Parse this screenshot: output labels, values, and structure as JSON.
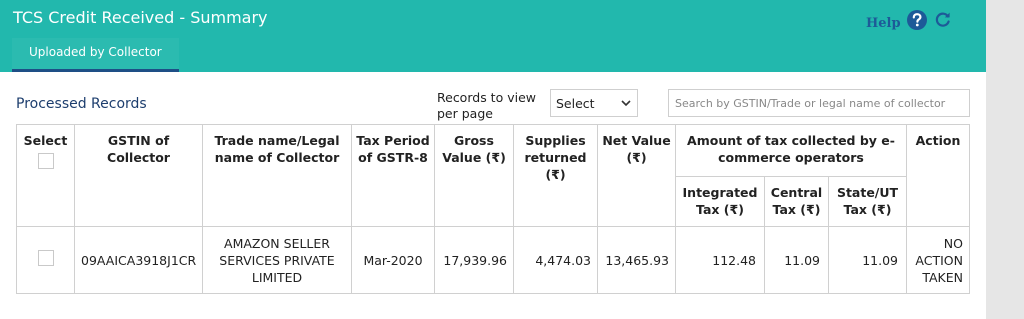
{
  "header": {
    "title": "TCS Credit Received - Summary",
    "help_label": "Help",
    "tab_label": "Uploaded by Collector",
    "help_icon": "help-circle-icon",
    "refresh_icon": "refresh-icon",
    "accent_color": "#22b8ad"
  },
  "toolbar": {
    "section_title": "Processed Records",
    "records_label": "Records to view per page",
    "select_value": "Select",
    "search_placeholder": "Search by GSTIN/Trade or legal name of collector"
  },
  "table": {
    "headers": {
      "select": "Select",
      "gstin": "GSTIN of Collector",
      "trade_name": "Trade name/Legal name of Collector",
      "tax_period": "Tax Period of GSTR-8",
      "gross_value": "Gross Value (₹)",
      "supplies_returned": "Supplies returned (₹)",
      "net_value": "Net Value (₹)",
      "amount_tax": "Amount of tax collected by e-commerce operators",
      "action": "Action",
      "integrated_tax": "Integrated Tax (₹)",
      "central_tax": "Central Tax (₹)",
      "state_ut_tax": "State/UT Tax (₹)"
    },
    "rows": [
      {
        "gstin": "09AAICA3918J1CR",
        "trade_name": "AMAZON SELLER SERVICES PRIVATE LIMITED",
        "tax_period": "Mar-2020",
        "gross_value": "17,939.96",
        "supplies_returned": "4,474.03",
        "net_value": "13,465.93",
        "integrated_tax": "112.48",
        "central_tax": "11.09",
        "state_ut_tax": "11.09",
        "action": "NO ACTION TAKEN"
      }
    ]
  }
}
